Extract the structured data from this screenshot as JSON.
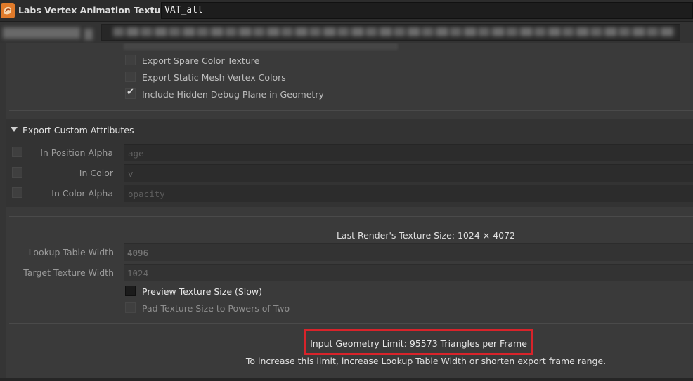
{
  "header": {
    "node_type": "Labs Vertex Animation Textures",
    "node_name": "VAT_all",
    "icon": "houdini-node-icon"
  },
  "colors": {
    "accent": "#e07a2a",
    "highlight_box": "#d8232a",
    "background": "#3a3a3a",
    "field": "#2c2c2c"
  },
  "export_options": {
    "spare_color": "Export Spare Color Texture",
    "static_mesh_colors": "Export Static Mesh Vertex Colors",
    "hidden_debug_plane": "Include Hidden Debug Plane in Geometry",
    "hidden_debug_plane_checked": true
  },
  "custom_attributes": {
    "title": "Export Custom Attributes",
    "expanded": true,
    "rows": [
      {
        "label": "In Position Alpha",
        "value": "age"
      },
      {
        "label": "In Color",
        "value": "v"
      },
      {
        "label": "In Color Alpha",
        "value": "opacity"
      }
    ]
  },
  "texture": {
    "last_render_size": "Last Render's Texture Size: 1024 × 4072",
    "lookup_width_label": "Lookup Table Width",
    "lookup_width_value": "4096",
    "target_width_label": "Target Texture Width",
    "target_width_value": "1024",
    "preview_label": "Preview Texture Size (Slow)",
    "pad_label": "Pad Texture Size to Powers of Two"
  },
  "limit": {
    "text": "Input Geometry Limit: 95573 Triangles per Frame",
    "hint": "To increase this limit, increase Lookup Table Width or shorten export frame range."
  }
}
